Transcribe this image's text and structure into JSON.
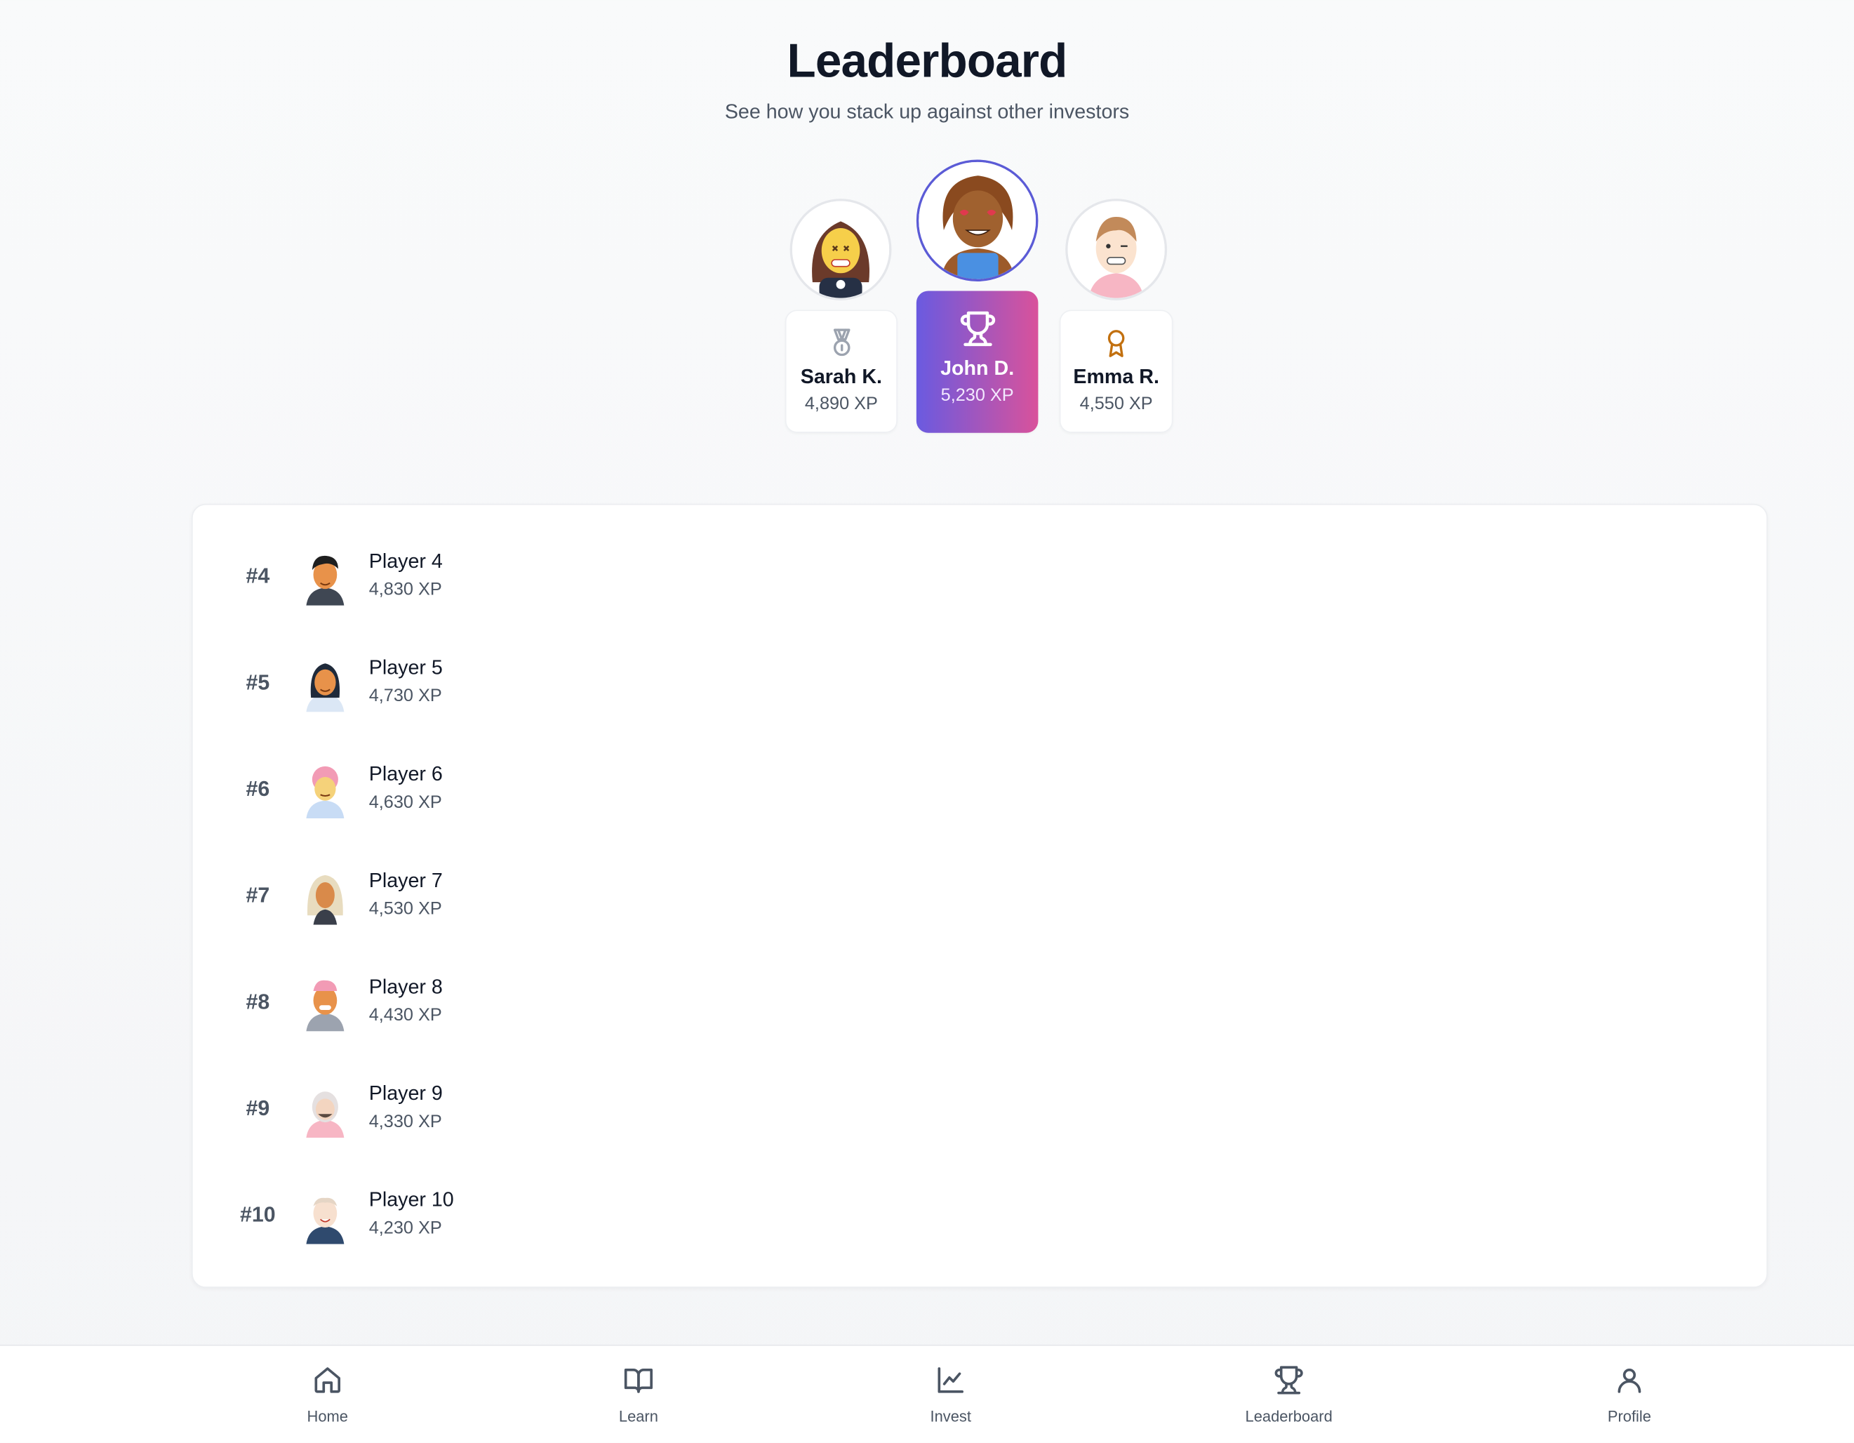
{
  "header": {
    "title": "Leaderboard",
    "subtitle": "See how you stack up against other investors"
  },
  "podium": {
    "first": {
      "name": "John D.",
      "xp": "5,230 XP",
      "medal_icon": "trophy-icon"
    },
    "second": {
      "name": "Sarah K.",
      "xp": "4,890 XP",
      "medal_icon": "medal-icon"
    },
    "third": {
      "name": "Emma R.",
      "xp": "4,550 XP",
      "medal_icon": "award-icon"
    }
  },
  "rankings": [
    {
      "rank": "#4",
      "name": "Player 4",
      "xp": "4,830 XP"
    },
    {
      "rank": "#5",
      "name": "Player 5",
      "xp": "4,730 XP"
    },
    {
      "rank": "#6",
      "name": "Player 6",
      "xp": "4,630 XP"
    },
    {
      "rank": "#7",
      "name": "Player 7",
      "xp": "4,530 XP"
    },
    {
      "rank": "#8",
      "name": "Player 8",
      "xp": "4,430 XP"
    },
    {
      "rank": "#9",
      "name": "Player 9",
      "xp": "4,330 XP"
    },
    {
      "rank": "#10",
      "name": "Player 10",
      "xp": "4,230 XP"
    }
  ],
  "nav": {
    "items": [
      {
        "label": "Home",
        "icon": "home-icon"
      },
      {
        "label": "Learn",
        "icon": "book-icon"
      },
      {
        "label": "Invest",
        "icon": "chart-icon"
      },
      {
        "label": "Leaderboard",
        "icon": "trophy-icon"
      },
      {
        "label": "Profile",
        "icon": "user-icon"
      }
    ]
  },
  "colors": {
    "accent_start": "#6a5ae0",
    "accent_end": "#d9529b",
    "ring": "#5b5bd6",
    "bronze": "#c2700f"
  }
}
